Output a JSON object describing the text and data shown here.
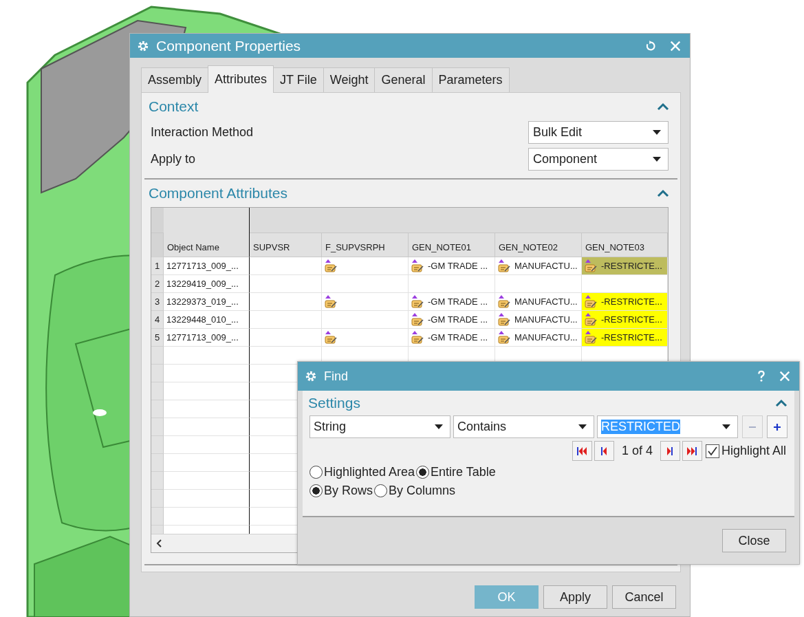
{
  "main_dialog": {
    "title": "Component Properties",
    "tabs": [
      {
        "label": "Assembly",
        "selected": false
      },
      {
        "label": "Attributes",
        "selected": true
      },
      {
        "label": "JT File",
        "selected": false
      },
      {
        "label": "Weight",
        "selected": false
      },
      {
        "label": "General",
        "selected": false
      },
      {
        "label": "Parameters",
        "selected": false
      }
    ],
    "context": {
      "title": "Context",
      "expanded": true,
      "fields": [
        {
          "label": "Interaction Method",
          "value": "Bulk Edit"
        },
        {
          "label": "Apply to",
          "value": "Component"
        }
      ]
    },
    "attributes": {
      "title": "Component Attributes",
      "expanded": true,
      "table": {
        "columns": [
          "Object Name",
          "SUPVSR",
          "F_SUPVSRPH",
          "GEN_NOTE01",
          "GEN_NOTE02",
          "GEN_NOTE03"
        ],
        "rows": [
          {
            "number": "1",
            "cells": [
              {
                "text": "12771713_009_...",
                "icon": false
              },
              {
                "icon": false
              },
              {
                "icon": true
              },
              {
                "text": "-GM TRADE ...",
                "icon": true
              },
              {
                "text": "MANUFACTU...",
                "icon": true
              },
              {
                "text": "-RESTRICTE...",
                "icon": true,
                "highlighted": true,
                "current": true
              }
            ]
          },
          {
            "number": "2",
            "cells": [
              {
                "text": "13229419_009_...",
                "icon": false
              },
              {
                "icon": false
              },
              {
                "icon": false
              },
              {
                "icon": false
              },
              {
                "icon": false
              },
              {
                "icon": false,
                "highlighted": false,
                "current": false
              }
            ]
          },
          {
            "number": "3",
            "cells": [
              {
                "text": "13229373_019_...",
                "icon": false
              },
              {
                "icon": false
              },
              {
                "icon": true
              },
              {
                "text": "-GM TRADE ...",
                "icon": true
              },
              {
                "text": "MANUFACTU...",
                "icon": true
              },
              {
                "text": "-RESTRICTE...",
                "icon": true,
                "highlighted": true,
                "current": false
              }
            ]
          },
          {
            "number": "4",
            "cells": [
              {
                "text": "13229448_010_...",
                "icon": false
              },
              {
                "icon": false
              },
              {
                "icon": false
              },
              {
                "text": "-GM TRADE ...",
                "icon": true
              },
              {
                "text": "MANUFACTU...",
                "icon": true
              },
              {
                "text": "-RESTRICTE...",
                "icon": true,
                "highlighted": true,
                "current": false
              }
            ]
          },
          {
            "number": "5",
            "cells": [
              {
                "text": "12771713_009_...",
                "icon": false
              },
              {
                "icon": false
              },
              {
                "icon": true
              },
              {
                "text": "-GM TRADE ...",
                "icon": true
              },
              {
                "text": "MANUFACTU...",
                "icon": true
              },
              {
                "text": "-RESTRICTE...",
                "icon": true,
                "highlighted": true,
                "current": false
              }
            ]
          }
        ]
      }
    },
    "buttons": [
      {
        "label": "OK",
        "default": true
      },
      {
        "label": "Apply",
        "default": false
      },
      {
        "label": "Cancel",
        "default": false
      }
    ]
  },
  "find_dialog": {
    "title": "Find",
    "settings": {
      "title": "Settings",
      "expanded": true,
      "type": "String",
      "operator": "Contains",
      "value": "RESTRICTED",
      "value_selected": true,
      "remove_disabled": true,
      "match_count": "1 of 4",
      "highlight_all": {
        "label": "Highlight All",
        "checked": true
      },
      "scope": [
        {
          "label": "Highlighted Area",
          "selected": false
        },
        {
          "label": "Entire Table",
          "selected": true
        }
      ],
      "order": [
        {
          "label": "By Rows",
          "selected": true
        },
        {
          "label": "By Columns",
          "selected": false
        }
      ]
    },
    "close_label": "Close"
  }
}
